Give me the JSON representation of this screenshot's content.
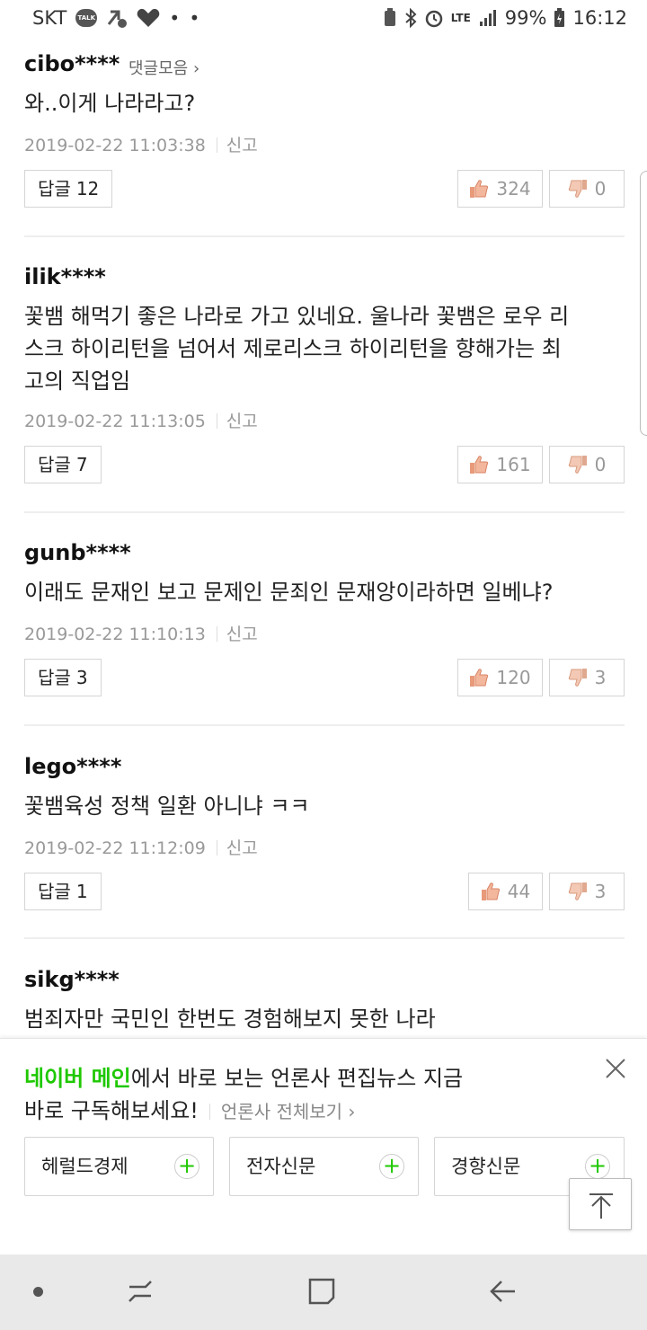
{
  "status_bar": {
    "carrier": "SKT",
    "talk_badge": "TALK",
    "network": "LTE",
    "battery": "99%",
    "time": "16:12"
  },
  "comments": [
    {
      "user": "cibo****",
      "more_link": "댓글모음",
      "text": "와..이게 나라라고?",
      "date": "2019-02-22 11:03:38",
      "report": "신고",
      "reply_label": "답글",
      "reply_count": "12",
      "likes": "324",
      "dislikes": "0"
    },
    {
      "user": "ilik****",
      "text": "꽃뱀 해먹기 좋은 나라로 가고 있네요. 울나라 꽃뱀은 로우 리스크 하이리턴을 넘어서 제로리스크 하이리턴을 향해가는 최고의 직업임",
      "text_lines": [
        "꽃뱀 해먹기 좋은 나라로 가고 있네요. 울나라 꽃뱀은 로우 리",
        "스크 하이리턴을 넘어서 제로리스크 하이리턴을 향해가는 최",
        "고의 직업임"
      ],
      "date": "2019-02-22 11:13:05",
      "report": "신고",
      "reply_label": "답글",
      "reply_count": "7",
      "likes": "161",
      "dislikes": "0"
    },
    {
      "user": "gunb****",
      "text": "이래도 문재인 보고 문제인 문죄인 문재앙이라하면 일베냐?",
      "date": "2019-02-22 11:10:13",
      "report": "신고",
      "reply_label": "답글",
      "reply_count": "3",
      "likes": "120",
      "dislikes": "3"
    },
    {
      "user": "lego****",
      "text": "꽃뱀육성 정책 일환 아니냐 ㅋㅋ",
      "date": "2019-02-22 11:12:09",
      "report": "신고",
      "reply_label": "답글",
      "reply_count": "1",
      "likes": "44",
      "dislikes": "3"
    },
    {
      "user": "sikg****",
      "text": "범죄자만 국민인 한번도 경험해보지 못한 나라"
    }
  ],
  "banner": {
    "highlight": "네이버 메인",
    "line1_rest": "에서 바로 보는 언론사 편집뉴스 지금",
    "line2": "바로 구독해보세요!",
    "all_press_link": "언론사 전체보기",
    "press": [
      "헤럴드경제",
      "전자신문",
      "경향신문"
    ]
  },
  "icons": {
    "thumb_up": "thumb-up-icon",
    "thumb_down": "thumb-down-icon",
    "close": "close-icon",
    "scroll_top": "arrow-up-icon",
    "nav_recent": "recent-apps-icon",
    "nav_home": "home-icon",
    "nav_back": "back-icon"
  },
  "colors": {
    "naver_green": "#1ec800",
    "thumb_up": "#e89a7a",
    "thumb_down": "#e0a98f"
  }
}
